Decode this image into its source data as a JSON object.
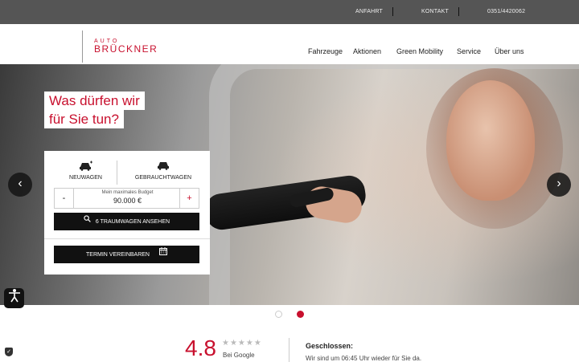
{
  "topbar": {
    "links": [
      "ANFAHRT",
      "KONTAKT",
      "0351/4420062"
    ]
  },
  "logo": {
    "line1": "AUTO",
    "line2": "BRÜCKNER"
  },
  "nav": {
    "items": [
      "Fahrzeuge",
      "Aktionen",
      "Green Mobility",
      "Service",
      "Über uns"
    ]
  },
  "hero": {
    "headline_line1": "Was dürfen wir",
    "headline_line2": "für Sie tun?",
    "prev_arrow": "‹",
    "next_arrow": "›"
  },
  "search_card": {
    "tabs": [
      "NEUWAGEN",
      "GEBRAUCHTWAGEN"
    ],
    "budget_label": "Mein maximales Budget",
    "budget_value": "90.000 €",
    "minus": "-",
    "plus": "+",
    "search_button": "6 TRAUMWAGEN ANSEHEN",
    "appointment_button": "TERMIN VEREINBAREN"
  },
  "carousel": {
    "slides": 2,
    "active": 2
  },
  "rating": {
    "score": "4.8",
    "stars": "★★★★★",
    "source": "Bei Google"
  },
  "opening": {
    "status": "Geschlossen:",
    "message": "Wir sind um 06:45 Uhr wieder für Sie da."
  },
  "colors": {
    "brand": "#c8102e",
    "topbar": "#555555",
    "button": "#111111"
  },
  "icons": [
    "car-plus-icon",
    "car-icon",
    "search-icon",
    "calendar-icon",
    "accessibility-icon",
    "shield-icon",
    "chevron-left-icon",
    "chevron-right-icon"
  ]
}
